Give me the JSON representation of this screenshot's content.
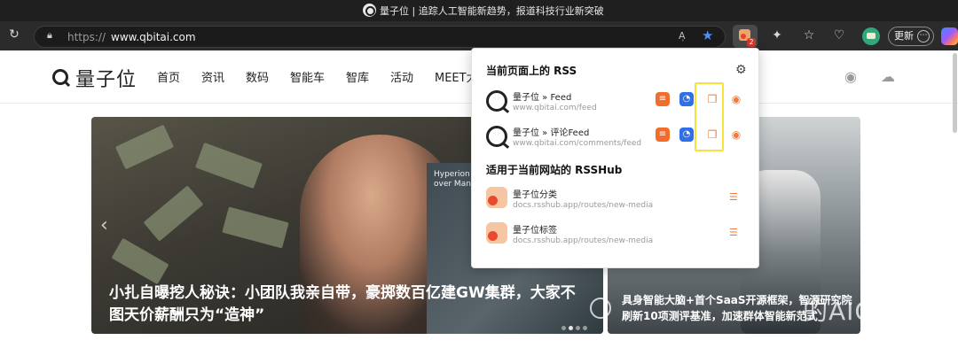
{
  "browser": {
    "window_title": "量子位 | 追踪人工智能新趋势，报道科技行业新突破",
    "url_protocol": "https://",
    "url_host": "www.qbitai.com",
    "reader_label": "Aͅ",
    "update_label": "更新",
    "rss_badge_count": "2"
  },
  "site": {
    "logo_text": "量子位",
    "nav": [
      "首页",
      "资讯",
      "数码",
      "智能车",
      "智库",
      "活动",
      "MEET大"
    ]
  },
  "hero": {
    "main_headline": "小扎自曝挖人秘诀：小团队我亲自带，豪掷数百亿建GW集群，大家不图天价薪酬只为“造神”",
    "map_text": "Hyperion\nover Manh",
    "side_headline": "具身智能大脑+首个SaaS开源框架，智源研究院刷新10项测评基准，加速群体智能新范式",
    "watermark": "的AIGC"
  },
  "rss_popup": {
    "section_current_title": "当前页面上的 RSS",
    "feeds": [
      {
        "name": "量子位 » Feed",
        "url": "www.qbitai.com/feed"
      },
      {
        "name": "量子位 » 评论Feed",
        "url": "www.qbitai.com/comments/feed"
      }
    ],
    "section_rsshub_title": "适用于当前网站的 RSSHub",
    "rsshub": [
      {
        "name": "量子位分类",
        "url": "docs.rsshub.app/routes/new-media"
      },
      {
        "name": "量子位标签",
        "url": "docs.rsshub.app/routes/new-media"
      }
    ]
  },
  "icons": {
    "accent_orange": "#f07a3a",
    "star_blue": "#4f8ef7",
    "highlight_yellow": "#f5e33a"
  }
}
